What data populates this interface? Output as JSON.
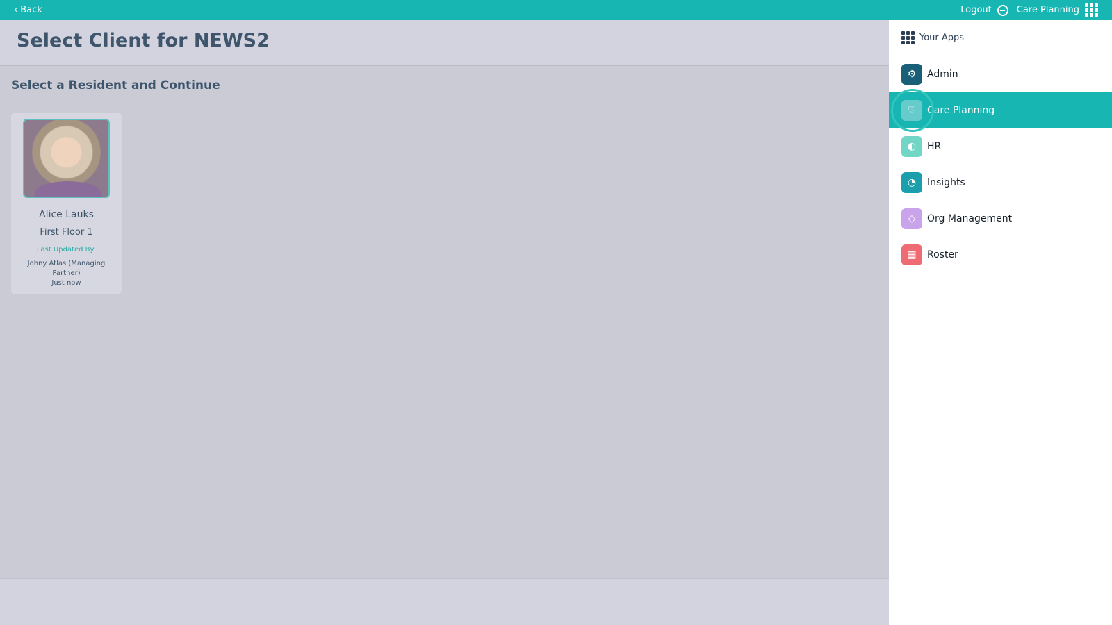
{
  "topbar": {
    "back_label": "Back",
    "logout_label": "Logout",
    "app_label": "Care Planning",
    "back_icon": "chevron-left-icon",
    "logout_icon": "logout-icon",
    "apps_icon": "grid-icon"
  },
  "header": {
    "title": "Select Client for NEWS2",
    "subtitle": "Select a Resident and Continue"
  },
  "resident": {
    "name": "Alice Lauks",
    "location": "First Floor 1",
    "updated_label": "Last Updated By:",
    "updated_by": "Johny Atlas (Managing Partner)",
    "updated_time": "Just now"
  },
  "drawer": {
    "title": "Your Apps",
    "apps": [
      {
        "label": "Admin",
        "icon": "gear-icon"
      },
      {
        "label": "Care Planning",
        "icon": "heart-icon"
      },
      {
        "label": "HR",
        "icon": "people-icon"
      },
      {
        "label": "Insights",
        "icon": "chart-icon"
      },
      {
        "label": "Org Management",
        "icon": "layers-icon"
      },
      {
        "label": "Roster",
        "icon": "calendar-icon"
      }
    ]
  },
  "colors": {
    "topbar": "#18b6b3",
    "heading": "#3e556c",
    "overlay": "#cbcbd6",
    "active_app": "#18b6b3"
  }
}
